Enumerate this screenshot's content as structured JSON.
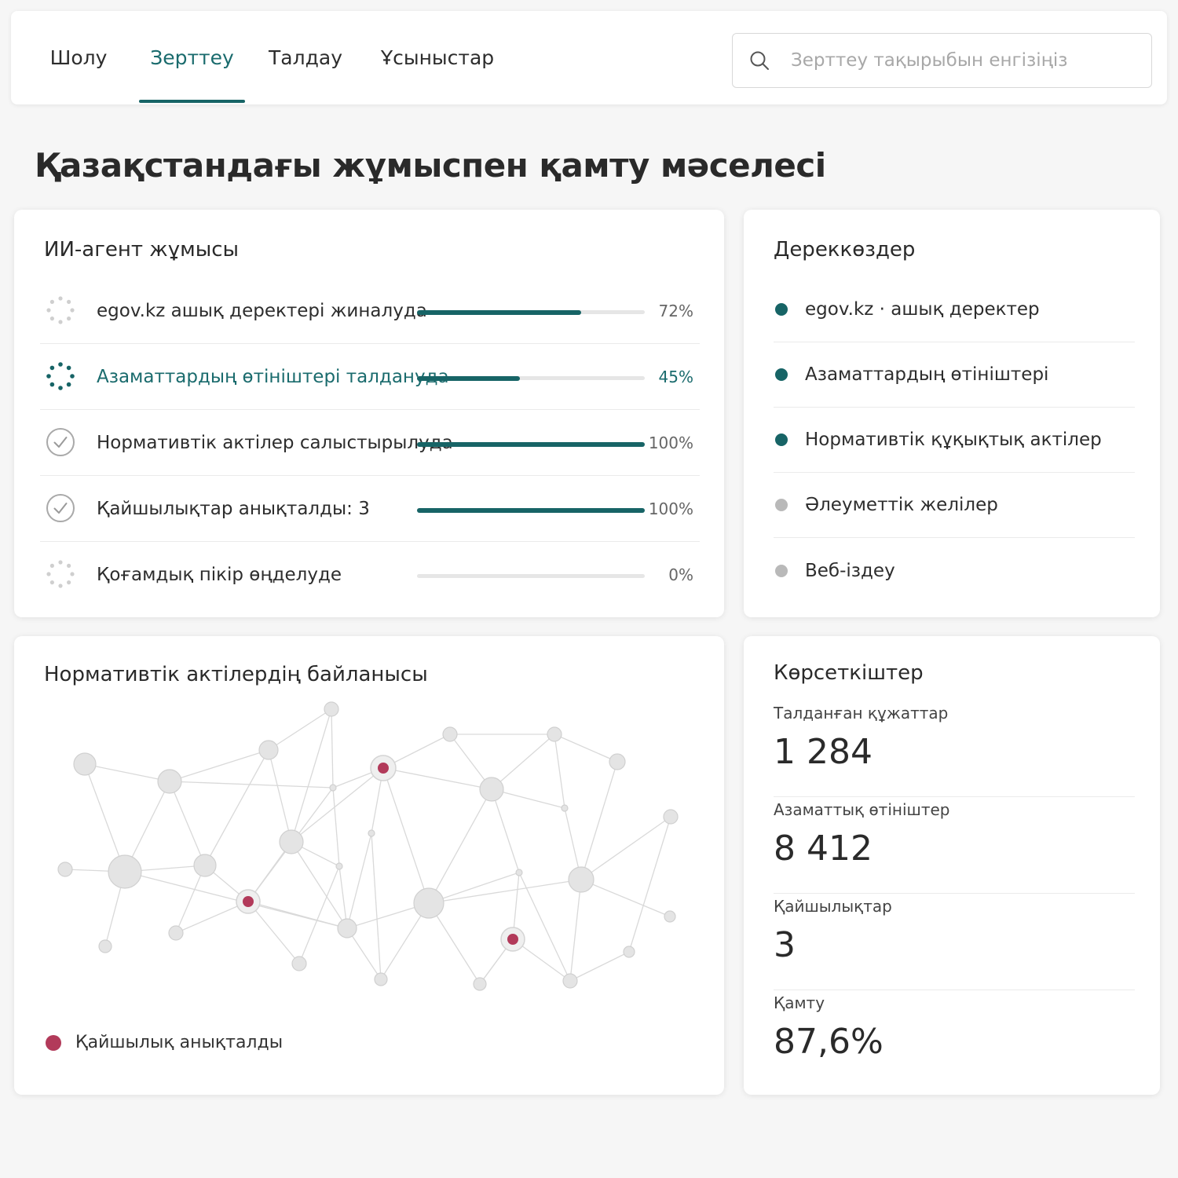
{
  "nav": {
    "tabs": [
      {
        "label": "Шолу",
        "active": false
      },
      {
        "label": "Зерттеу",
        "active": true
      },
      {
        "label": "Талдау",
        "active": false
      },
      {
        "label": "Ұсыныстар",
        "active": false
      }
    ],
    "search_placeholder": "Зерттеу тақырыбын енгізіңіз"
  },
  "page_title": "Қазақстандағы жұмыспен қамту мәселесі",
  "agent": {
    "title": "ИИ-агент жұмысы",
    "tasks": [
      {
        "label": "egov.kz ашық деректері жиналуда",
        "progress": 72,
        "progress_text": "72%",
        "status": "loading"
      },
      {
        "label": "Азаматтардың өтініштері талдануда",
        "progress": 45,
        "progress_text": "45%",
        "status": "active"
      },
      {
        "label": "Нормативтік актілер салыстырылуда",
        "progress": 100,
        "progress_text": "100%",
        "status": "done"
      },
      {
        "label": "Қайшылықтар анықталды: 3",
        "progress": 100,
        "progress_text": "100%",
        "status": "done"
      },
      {
        "label": "Қоғамдық пікір өңделуде",
        "progress": 0,
        "progress_text": "0%",
        "status": "loading"
      }
    ]
  },
  "sources": {
    "title": "Дереккөздер",
    "items": [
      {
        "label": "egov.kz · ашық деректер",
        "active": true
      },
      {
        "label": "Азаматтардың өтініштері",
        "active": true
      },
      {
        "label": "Нормативтік құқықтық актілер",
        "active": true
      },
      {
        "label": "Әлеуметтік желілер",
        "active": false
      },
      {
        "label": "Веб-іздеу",
        "active": false
      }
    ]
  },
  "network": {
    "title": "Нормативтік актілердің байланысы",
    "legend_label": "Қайшылық анықталды"
  },
  "metrics": {
    "title": "Көрсеткіштер",
    "items": [
      {
        "label": "Талданған құжаттар",
        "value": "1 284"
      },
      {
        "label": "Азаматтық өтініштер",
        "value": "8 412"
      },
      {
        "label": "Қайшылықтар",
        "value": "3"
      },
      {
        "label": "Қамту",
        "value": "87,6%"
      }
    ]
  },
  "colors": {
    "accent": "#176466",
    "accent_text": "#1a6b6d",
    "conflict": "#b23a5a",
    "inactive_dot": "#b9b9b9",
    "node_fill": "#e4e4e4",
    "node_stroke": "#d0d0d0"
  }
}
